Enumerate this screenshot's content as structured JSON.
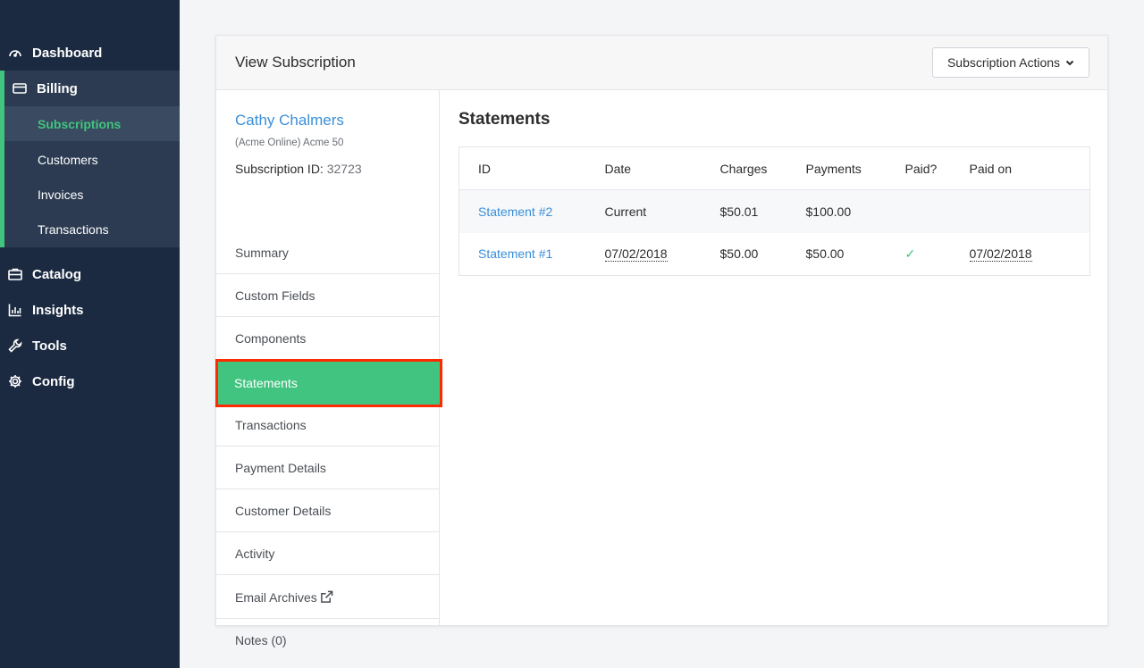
{
  "sidebar": {
    "dashboard": {
      "label": "Dashboard",
      "icon": "dashboard-icon"
    },
    "billing": {
      "label": "Billing",
      "icon": "credit-card-icon"
    },
    "sub_items": [
      "Subscriptions",
      "Customers",
      "Invoices",
      "Transactions"
    ],
    "catalog": {
      "label": "Catalog",
      "icon": "briefcase-icon"
    },
    "insights": {
      "label": "Insights",
      "icon": "bar-chart-icon"
    },
    "tools": {
      "label": "Tools",
      "icon": "wrench-icon"
    },
    "config": {
      "label": "Config",
      "icon": "gear-icon"
    }
  },
  "card": {
    "title": "View Subscription",
    "actions_label": "Subscription Actions"
  },
  "customer": {
    "name": "Cathy Chalmers",
    "plan": "(Acme Online) Acme 50",
    "sub_id_label": "Subscription ID:",
    "sub_id": "32723"
  },
  "menu": [
    "Summary",
    "Custom Fields",
    "Components",
    "Statements",
    "Transactions",
    "Payment Details",
    "Customer Details",
    "Activity",
    "Email Archives",
    "Notes (0)"
  ],
  "statements": {
    "title": "Statements",
    "columns": [
      "ID",
      "Date",
      "Charges",
      "Payments",
      "Paid?",
      "Paid on"
    ],
    "rows": [
      {
        "id": "Statement #2",
        "date": "Current",
        "charges": "$50.01",
        "payments": "$100.00",
        "paid": "",
        "paid_on": ""
      },
      {
        "id": "Statement #1",
        "date": "07/02/2018",
        "charges": "$50.00",
        "payments": "$50.00",
        "paid": "✓",
        "paid_on": "07/02/2018"
      }
    ]
  },
  "colors": {
    "sidebar_bg": "#1b2a41",
    "accent_green": "#41c47f",
    "link_blue": "#3a8fd9",
    "highlight_red": "#ff2a00"
  }
}
